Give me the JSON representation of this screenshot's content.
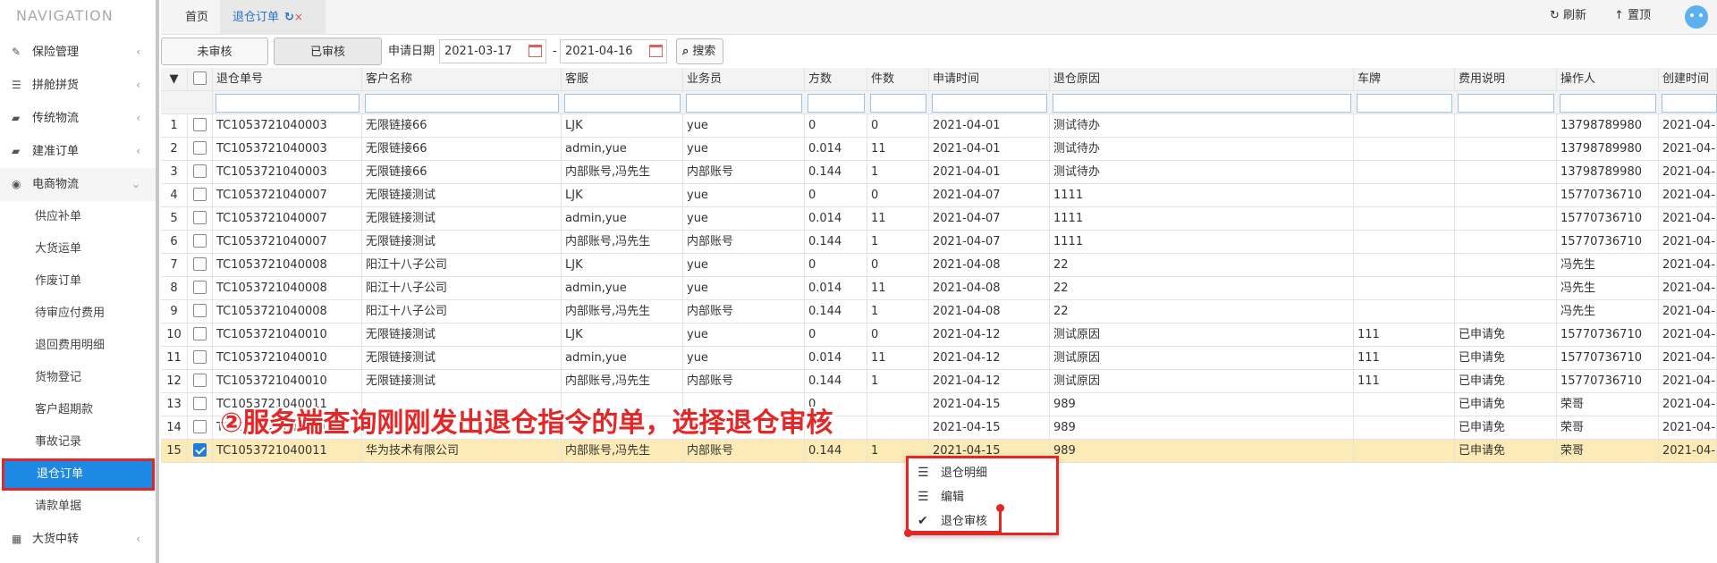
{
  "nav": {
    "title": "NAVIGATION",
    "items": [
      {
        "label": "保险管理",
        "icon": "edit-icon"
      },
      {
        "label": "拼舱拼货",
        "icon": "list-icon"
      },
      {
        "label": "传统物流",
        "icon": "truck-icon"
      },
      {
        "label": "建准订单",
        "icon": "truck-icon"
      },
      {
        "label": "电商物流",
        "icon": "globe-icon",
        "open": true
      }
    ],
    "sub_items": [
      "供应补单",
      "大货运单",
      "作废订单",
      "待审应付费用",
      "退回费用明细",
      "货物登记",
      "客户超期款",
      "事故记录",
      "退仓订单",
      "请款单据"
    ],
    "active_sub": "退仓订单",
    "last_item": {
      "label": "大货中转",
      "icon": "grid-icon"
    }
  },
  "tabs": {
    "home": "首页",
    "current": "退仓订单"
  },
  "topright": {
    "refresh": "刷新",
    "top": "置顶"
  },
  "toolbar": {
    "tab_unreviewed": "未审核",
    "tab_reviewed": "已审核",
    "date_label": "申请日期",
    "date_from": "2021-03-17",
    "date_sep": "-",
    "date_to": "2021-04-16",
    "search_label": "搜索"
  },
  "columns": [
    "退仓单号",
    "客户名称",
    "客服",
    "业务员",
    "方数",
    "件数",
    "申请时间",
    "退仓原因",
    "车牌",
    "费用说明",
    "操作人",
    "创建时间"
  ],
  "rows": [
    {
      "n": "1",
      "no": "TC1053721040003",
      "cust": "无限链接66",
      "cs": "LJK",
      "sales": "yue",
      "vol": "0",
      "qty": "0",
      "date": "2021-04-01",
      "reason": "测试待办",
      "plate": "",
      "fee": "",
      "op": "13798789980",
      "ct": "2021-04-"
    },
    {
      "n": "2",
      "no": "TC1053721040003",
      "cust": "无限链接66",
      "cs": "admin,yue",
      "sales": "yue",
      "vol": "0.014",
      "qty": "11",
      "date": "2021-04-01",
      "reason": "测试待办",
      "plate": "",
      "fee": "",
      "op": "13798789980",
      "ct": "2021-04-"
    },
    {
      "n": "3",
      "no": "TC1053721040003",
      "cust": "无限链接66",
      "cs": "内部账号,冯先生",
      "sales": "内部账号",
      "vol": "0.144",
      "qty": "1",
      "date": "2021-04-01",
      "reason": "测试待办",
      "plate": "",
      "fee": "",
      "op": "13798789980",
      "ct": "2021-04-"
    },
    {
      "n": "4",
      "no": "TC1053721040007",
      "cust": "无限链接测试",
      "cs": "LJK",
      "sales": "yue",
      "vol": "0",
      "qty": "0",
      "date": "2021-04-07",
      "reason": "1111",
      "plate": "",
      "fee": "",
      "op": "15770736710",
      "ct": "2021-04-"
    },
    {
      "n": "5",
      "no": "TC1053721040007",
      "cust": "无限链接测试",
      "cs": "admin,yue",
      "sales": "yue",
      "vol": "0.014",
      "qty": "11",
      "date": "2021-04-07",
      "reason": "1111",
      "plate": "",
      "fee": "",
      "op": "15770736710",
      "ct": "2021-04-"
    },
    {
      "n": "6",
      "no": "TC1053721040007",
      "cust": "无限链接测试",
      "cs": "内部账号,冯先生",
      "sales": "内部账号",
      "vol": "0.144",
      "qty": "1",
      "date": "2021-04-07",
      "reason": "1111",
      "plate": "",
      "fee": "",
      "op": "15770736710",
      "ct": "2021-04-"
    },
    {
      "n": "7",
      "no": "TC1053721040008",
      "cust": "阳江十八子公司",
      "cs": "LJK",
      "sales": "yue",
      "vol": "0",
      "qty": "0",
      "date": "2021-04-08",
      "reason": "22",
      "plate": "",
      "fee": "",
      "op": "冯先生",
      "ct": "2021-04-"
    },
    {
      "n": "8",
      "no": "TC1053721040008",
      "cust": "阳江十八子公司",
      "cs": "admin,yue",
      "sales": "yue",
      "vol": "0.014",
      "qty": "11",
      "date": "2021-04-08",
      "reason": "22",
      "plate": "",
      "fee": "",
      "op": "冯先生",
      "ct": "2021-04-"
    },
    {
      "n": "9",
      "no": "TC1053721040008",
      "cust": "阳江十八子公司",
      "cs": "内部账号,冯先生",
      "sales": "内部账号",
      "vol": "0.144",
      "qty": "1",
      "date": "2021-04-08",
      "reason": "22",
      "plate": "",
      "fee": "",
      "op": "冯先生",
      "ct": "2021-04-"
    },
    {
      "n": "10",
      "no": "TC1053721040010",
      "cust": "无限链接测试",
      "cs": "LJK",
      "sales": "yue",
      "vol": "0",
      "qty": "0",
      "date": "2021-04-12",
      "reason": "测试原因",
      "plate": "111",
      "fee": "已申请免",
      "op": "15770736710",
      "ct": "2021-04-"
    },
    {
      "n": "11",
      "no": "TC1053721040010",
      "cust": "无限链接测试",
      "cs": "admin,yue",
      "sales": "yue",
      "vol": "0.014",
      "qty": "11",
      "date": "2021-04-12",
      "reason": "测试原因",
      "plate": "111",
      "fee": "已申请免",
      "op": "15770736710",
      "ct": "2021-04-"
    },
    {
      "n": "12",
      "no": "TC1053721040010",
      "cust": "无限链接测试",
      "cs": "内部账号,冯先生",
      "sales": "内部账号",
      "vol": "0.144",
      "qty": "1",
      "date": "2021-04-12",
      "reason": "测试原因",
      "plate": "111",
      "fee": "已申请免",
      "op": "15770736710",
      "ct": "2021-04-"
    },
    {
      "n": "13",
      "no": "TC1053721040011",
      "cust": "",
      "cs": "",
      "sales": "",
      "vol": "0",
      "qty": "",
      "date": "2021-04-15",
      "reason": "989",
      "plate": "",
      "fee": "已申请免",
      "op": "荣哥",
      "ct": "2021-04-"
    },
    {
      "n": "14",
      "no": "TC1053721040011",
      "cust": "",
      "cs": "",
      "sales": "yue",
      "vol": "",
      "qty": "",
      "date": "2021-04-15",
      "reason": "989",
      "plate": "",
      "fee": "已申请免",
      "op": "荣哥",
      "ct": "2021-04-"
    },
    {
      "n": "15",
      "no": "TC1053721040011",
      "cust": "华为技术有限公司",
      "cs": "内部账号,冯先生",
      "sales": "内部账号",
      "vol": "0.144",
      "qty": "1",
      "date": "2021-04-15",
      "reason": "989",
      "plate": "",
      "fee": "已申请免",
      "op": "荣哥",
      "ct": "2021-04-",
      "selected": true
    }
  ],
  "annotation": "②服务端查询刚刚发出退仓指令的单，选择退仓审核",
  "context_menu": [
    {
      "label": "退仓明细",
      "icon": "list-icon"
    },
    {
      "label": "编辑",
      "icon": "list-icon"
    },
    {
      "label": "退仓审核",
      "icon": "check-icon"
    }
  ],
  "colors": {
    "accent": "#1e88e5",
    "highlight": "#e32626",
    "selected_row": "#fcebb6"
  }
}
